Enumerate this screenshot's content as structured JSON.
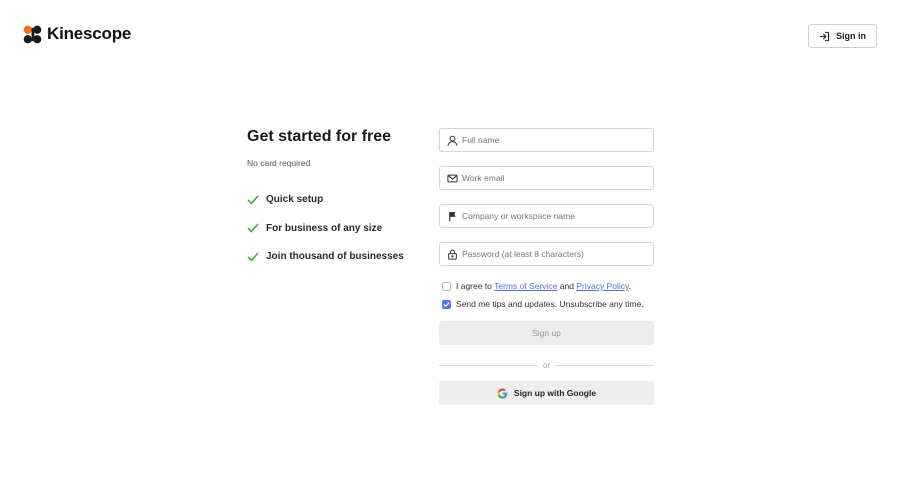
{
  "header": {
    "brand_name": "Kinescope",
    "logo_icon": "kinescope-logo-icon",
    "signin": {
      "label": "Sign in",
      "icon": "sign-in-icon"
    }
  },
  "hero": {
    "title": "Get started for free",
    "subtitle": "No card required",
    "features": [
      {
        "label": "Quick setup",
        "icon": "check-icon"
      },
      {
        "label": "For business of any size",
        "icon": "check-icon"
      },
      {
        "label": "Join thousand of businesses",
        "icon": "check-icon"
      }
    ],
    "check_color": "#3cb043"
  },
  "form": {
    "fields": [
      {
        "name": "full-name",
        "placeholder": "Full name",
        "value": "",
        "icon": "user-icon"
      },
      {
        "name": "work-email",
        "placeholder": "Work email",
        "value": "",
        "icon": "mail-icon"
      },
      {
        "name": "company",
        "placeholder": "Company or workspace name",
        "value": "",
        "icon": "flag-icon"
      },
      {
        "name": "password",
        "placeholder": "Password (at least 8 characters)",
        "value": "",
        "icon": "lock-icon"
      }
    ],
    "agree": {
      "checked": false,
      "prefix": "I agree to ",
      "terms_link": "Terms of Service",
      "middle": " and ",
      "privacy_link": "Privacy Policy",
      "suffix": "."
    },
    "tips": {
      "checked": true,
      "label": "Send me tips and updates. Unsubscribe any time."
    },
    "signup_label": "Sign up",
    "divider_text": "or",
    "google": {
      "label": "Sign up with Google",
      "icon": "google-icon"
    }
  },
  "colors": {
    "link": "#5a6fd8",
    "checkbox_checked": "#5a75e8",
    "logo_orange": "#f26b1d"
  }
}
